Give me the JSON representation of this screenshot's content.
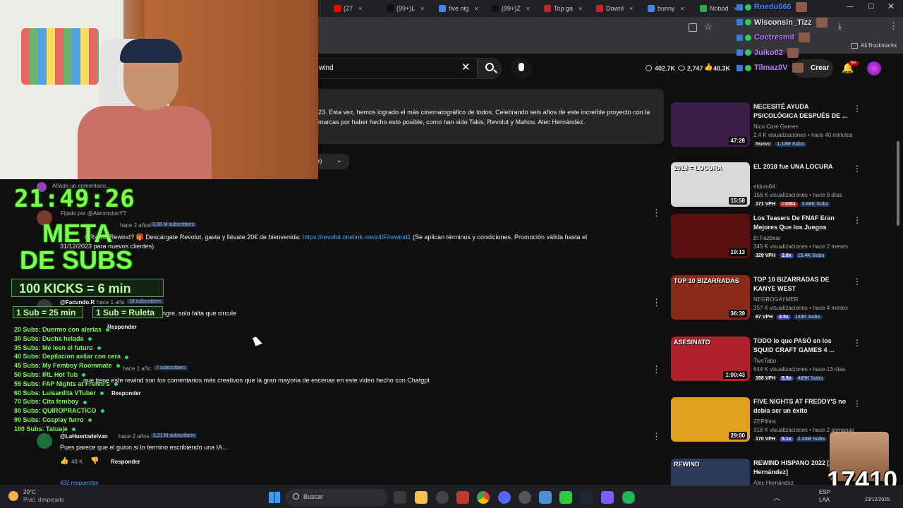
{
  "browser": {
    "tabs": [
      {
        "label": "(27",
        "color": "#ff0000"
      },
      {
        "label": "(99+)L",
        "color": "#111111"
      },
      {
        "label": "five nig",
        "color": "#4285f4"
      },
      {
        "label": "(99+)Z",
        "color": "#111111"
      },
      {
        "label": "Top ga",
        "color": "#c62828"
      },
      {
        "label": "Downl",
        "color": "#c62828"
      },
      {
        "label": "bunny",
        "color": "#4285f4"
      },
      {
        "label": "Nobod",
        "color": "#34a853"
      }
    ],
    "bookmarks_label": "All Bookmarks"
  },
  "youtube": {
    "search_text": "wind",
    "stats": {
      "views": "402.7K",
      "watching": "2,747",
      "likes": "48.3K"
    },
    "create_label": "Crear",
    "notif_badge": "9+"
  },
  "description": {
    "line1": "23. Esta vez, hemos logrado el más cinematográfico de todos. Celebrando seis años de este increíble proyecto con la",
    "line2": "marcas por haber hecho esto posible, como han sido Takis, Revolut y Mahou. Alec Hernández.",
    "sort_label": "r)"
  },
  "comments": {
    "add_placeholder": "Añade un comentario...",
    "pinned_label": "Fijado por @AlecmolonYT",
    "c1": {
      "age": "hace 2 años",
      "subs": "3,06 M subscribers",
      "text_a": "QRs del Rewind? 🎁 Descárgate Revolut, gasta y llévate 20€ de bienvenida: ",
      "link": "https://revolut.onelink.me/z4lF/rewind1",
      "text_b": " (Se aplican términos y condiciones. Promoción válida hasta el",
      "text_c": "31/12/2023 para nuevos clientes)"
    },
    "c2": {
      "user": "@Facundo.R",
      "age": "hace 1 año",
      "subs": "18 subscribers",
      "text": "ngre, solo falta que circule",
      "reply": "Responder"
    },
    "c3": {
      "age": "hace 1 año",
      "subs": "7 subscribers",
      "text": "que tiene este rewind son los comentarios más creativos que la gran mayoria de escenas en este video hecho con Chatgpt",
      "reply": "Responder"
    },
    "c4": {
      "user": "@LaHuertadelvan",
      "age": "hace 2 años",
      "subs": "1,21 M subscribers",
      "text": "Pues parece que el guion si lo termino escribiendo una IA...",
      "likes": "48 K",
      "reply": "Responder",
      "replies": "432 respuestas"
    }
  },
  "recommendations": [
    {
      "title": "NECESITÉ AYUDA PSICOLÓGICA DESPUÉS DE ...",
      "channel": "Nico Core Games",
      "meta": "2,4 K visualizaciones • hace 40 minutos",
      "badge": "Nuevo",
      "extra": "1.13M Subs",
      "duration": "47:28",
      "bg": "#3a1f4a"
    },
    {
      "title": "EL 2018 fue UNA LOCURA",
      "channel": "eldum64",
      "meta": "156 K visualizaciones • hace 9 días",
      "vph": "171 VPH",
      "mult": ">100x",
      "subs": "3.88K Subs",
      "duration": "15:58",
      "bg": "#d9d9d9",
      "thumb_text": "2018 = LOCURA"
    },
    {
      "title": "Los Teasers De FNAF Eran Mejores Que los Juegos",
      "channel": "El Fazbear",
      "meta": "345 K visualizaciones • hace 2 meses",
      "vph": "329 VPH",
      "mult": "3.8x",
      "subs": "15.4K Subs",
      "duration": "19:13",
      "bg": "#5a1010"
    },
    {
      "title": "TOP 10 BIZARRADAS DE KANYE WEST",
      "channel": "NEGROGAYMER",
      "meta": "357 K visualizaciones • hace 4 meses",
      "vph": "67 VPH",
      "mult": "4.5x",
      "subs": "143K Subs",
      "duration": "36:39",
      "bg": "#8a2a1a",
      "thumb_text": "TOP 10 BIZARRADAS"
    },
    {
      "title": "TODO lo que PASÓ en los SQUID CRAFT GAMES 4 ...",
      "channel": "TivoTabo",
      "meta": "644 K visualizaciones • hace 13 días",
      "vph": "358 VPH",
      "mult": "5.9x",
      "subs": "489K Subs",
      "duration": "1:00:43",
      "bg": "#b0202a",
      "thumb_text": "ASESINATO"
    },
    {
      "title": "FIVE NIGHTS AT FREDDY'S no debía ser un éxito",
      "channel": "ZEPfilms",
      "meta": "316 K visualizaciones • hace 2 semanas",
      "vph": "170 VPH",
      "mult": "5.1x",
      "subs": "2.24M Subs",
      "duration": "29:00",
      "bg": "#e0a020"
    },
    {
      "title": "REWIND HISPANO 2022 [A Hernández]",
      "channel": "Alec Hernández",
      "meta": "",
      "duration": "",
      "bg": "#2a3a5a",
      "thumb_text": "REWIND"
    }
  ],
  "overlay": {
    "clock": "21:49:26",
    "meta_line1": "META",
    "meta_line2": "DE SUBS",
    "kicks": "100 KICKS = 6 min",
    "sub_rate": "1 Sub = 25 min",
    "sub_ruleta": "1 Sub = Ruleta",
    "goals": [
      "20 Subs: Duermo con alertas",
      "30 Subs: Ducha helada",
      "35 Subs: Me leen el futuro",
      "40 Subs: Depilacion axilar con cera",
      "45 Subs: My Femboy Roommate",
      "50 Subs: IRL Hot Tub",
      "55 Subs: FAP Nights at Frenni's",
      "60 Subs: Luisardita VTuber",
      "70 Subs: Cita femboy",
      "80 Subs: QUIROPRACTICO",
      "90 Subs: Cosplay furro",
      "100 Subs: Tatuaje"
    ],
    "counter": "17410"
  },
  "chat": [
    {
      "user": "Rnedu666",
      "color": "#4b86ff"
    },
    {
      "user": "Wisconsin_Tizz",
      "color": "#e8e8ff"
    },
    {
      "user": "Coctresmil",
      "color": "#c27bff"
    },
    {
      "user": "Juiko02",
      "color": "#c27bff"
    },
    {
      "user": "Tilmaz0V",
      "color": "#c27bff"
    }
  ],
  "taskbar": {
    "weather_temp": "20°C",
    "weather_desc": "Prac. despejado",
    "search_label": "Buscar",
    "lang": "ESP",
    "lang2": "LAA",
    "date": "23/12/2025"
  }
}
